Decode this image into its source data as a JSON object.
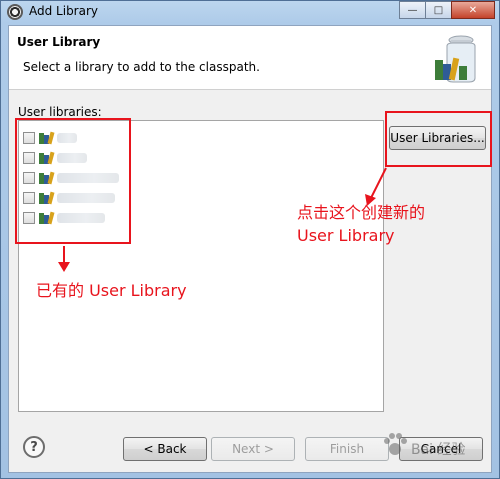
{
  "window": {
    "title": "Add Library",
    "icon": "eclipse-icon",
    "controls": {
      "minimize": "—",
      "maximize": "□",
      "close": "✕"
    }
  },
  "header": {
    "title": "User Library",
    "description": "Select a library to add to the classpath."
  },
  "libraries": {
    "label": "User libraries:",
    "items": [
      {
        "checked": false,
        "name": ""
      },
      {
        "checked": false,
        "name": ""
      },
      {
        "checked": false,
        "name": ""
      },
      {
        "checked": false,
        "name": ""
      },
      {
        "checked": false,
        "name": ""
      }
    ]
  },
  "buttons": {
    "user_libraries": "User Libraries...",
    "help": "?",
    "back": "< Back",
    "next": "Next >",
    "finish": "Finish",
    "cancel": "Cancel"
  },
  "annotations": {
    "existing_label": "已有的 User Library",
    "create_line1": "点击这个创建新的",
    "create_line2": "User Library",
    "color": "#e8141d"
  },
  "watermark": {
    "text": "Bai 经验"
  }
}
